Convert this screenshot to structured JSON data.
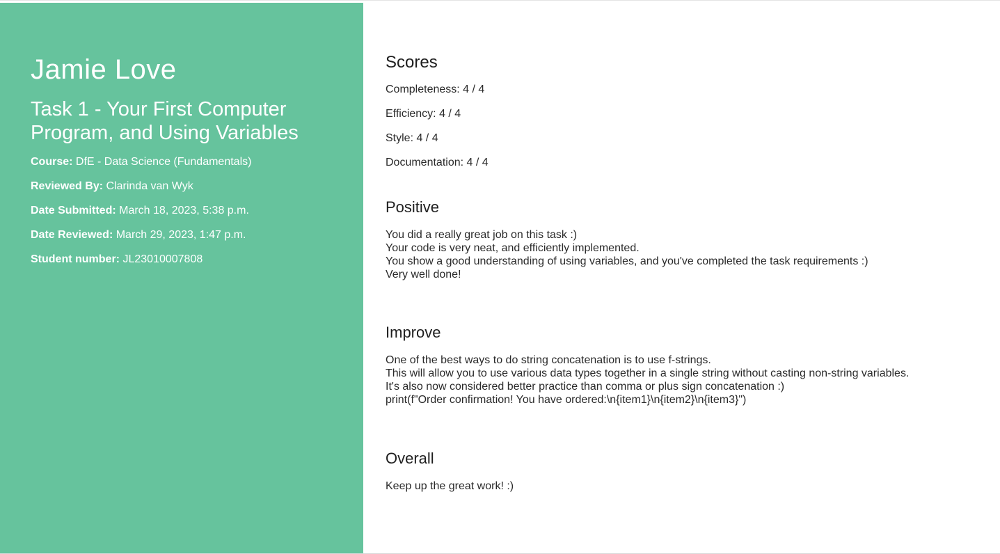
{
  "sidebar": {
    "student_name": "Jamie Love",
    "task_title": "Task 1 - Your First Computer Program, and Using Variables",
    "meta": [
      {
        "label": "Course:",
        "value": "DfE - Data Science (Fundamentals)"
      },
      {
        "label": "Reviewed By:",
        "value": "Clarinda van Wyk"
      },
      {
        "label": "Date Submitted:",
        "value": "March 18, 2023, 5:38 p.m."
      },
      {
        "label": "Date Reviewed:",
        "value": "March 29, 2023, 1:47 p.m."
      },
      {
        "label": "Student number:",
        "value": "JL23010007808"
      }
    ]
  },
  "main": {
    "scores": {
      "heading": "Scores",
      "items": [
        "Completeness: 4 / 4",
        "Efficiency: 4 / 4",
        "Style: 4 / 4",
        "Documentation: 4 / 4"
      ]
    },
    "positive": {
      "heading": "Positive",
      "lines": [
        "You did a really great job on this task :)",
        "Your code is very neat, and efficiently implemented.",
        "You show a good understanding of using variables, and you've completed the task requirements :)",
        "Very well done!"
      ]
    },
    "improve": {
      "heading": "Improve",
      "lines": [
        "One of the best ways to do string concatenation is to use f-strings.",
        "This will allow you to use various data types together in a single string without casting non-string variables.",
        "It's also now considered better practice than comma or plus sign concatenation :)",
        "print(f\"Order confirmation! You have ordered:\\n{item1}\\n{item2}\\n{item3}\")"
      ]
    },
    "overall": {
      "heading": "Overall",
      "lines": [
        "Keep up the great work! :)"
      ]
    }
  },
  "colors": {
    "sidebar_background": "#66c39d",
    "sidebar_text": "#ffffff",
    "main_text": "#2a2a2a"
  }
}
